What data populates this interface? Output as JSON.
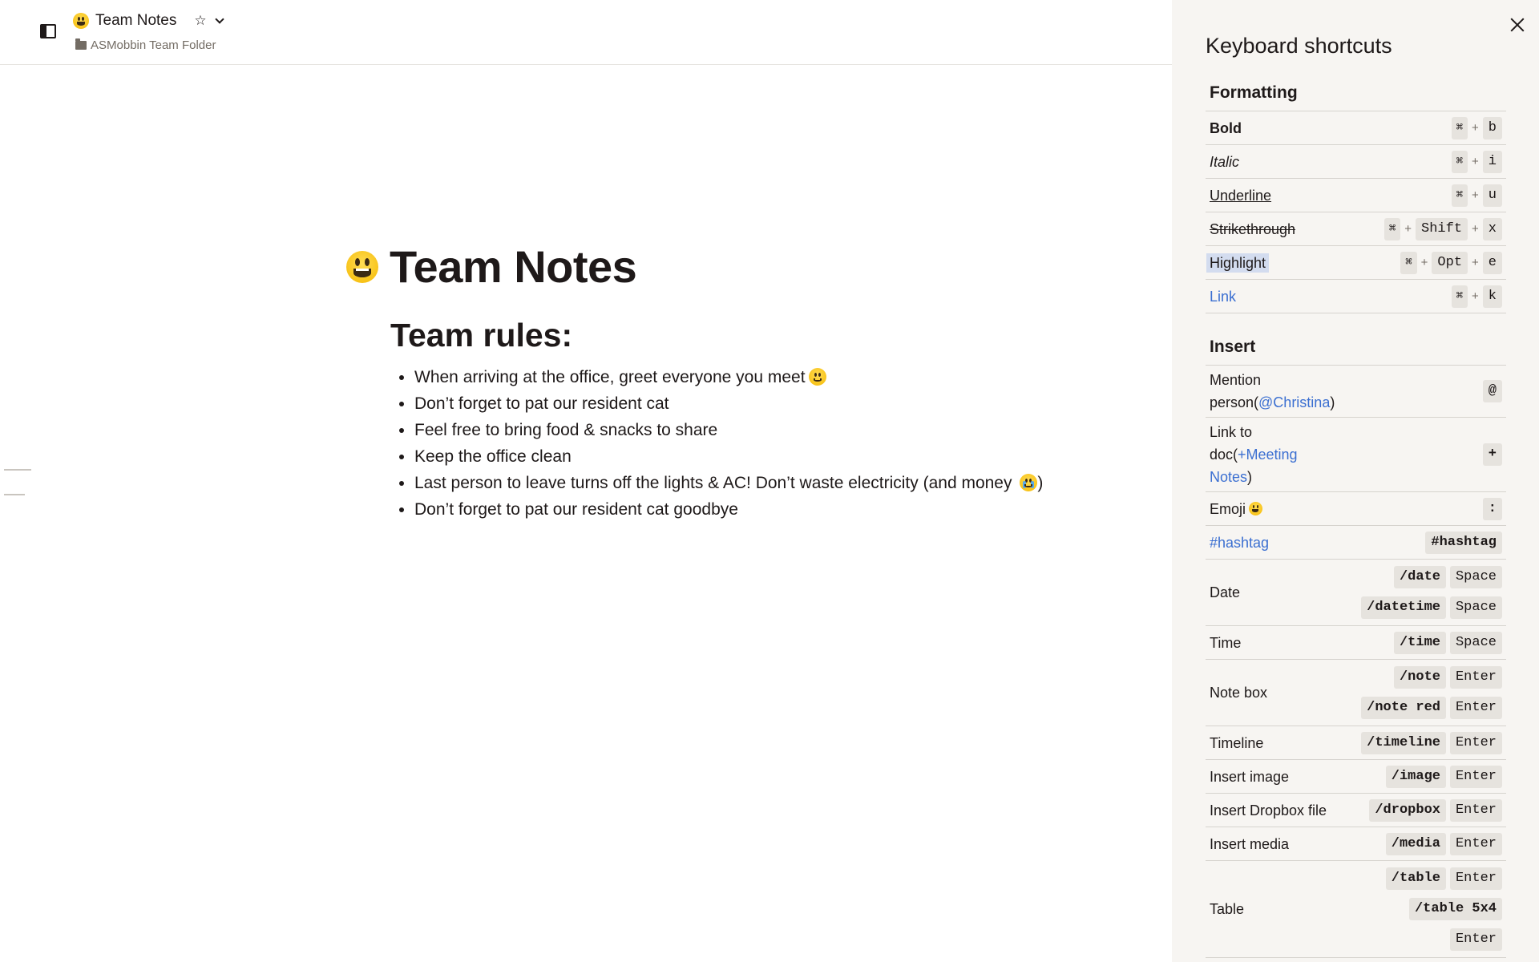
{
  "header": {
    "title": "Team Notes",
    "breadcrumb": "ASMobbin Team Folder"
  },
  "doc": {
    "title": "Team Notes",
    "section_title": "Team rules:",
    "rules": [
      "When arriving at the office, greet everyone you meet",
      "Don’t forget to pat our resident cat",
      "Feel free to bring food & snacks to share",
      "Keep the office clean",
      "Last person to leave turns off the lights & AC! Don’t waste electricity (and money",
      "Don’t forget to pat our resident cat goodbye"
    ],
    "rule5_close": ")"
  },
  "panel": {
    "title": "Keyboard shortcuts",
    "formatting_title": "Formatting",
    "insert_title": "Insert",
    "cmd": "⌘",
    "plus": "+",
    "formatting": {
      "bold": {
        "label": "Bold",
        "key": "b"
      },
      "italic": {
        "label": "Italic",
        "key": "i"
      },
      "underline": {
        "label": "Underline",
        "key": "u"
      },
      "strikethrough": {
        "label": "Strikethrough",
        "mod": "Shift",
        "key": "x"
      },
      "highlight": {
        "label": "Highlight",
        "mod": "Opt",
        "key": "e"
      },
      "link": {
        "label": "Link",
        "key": "k"
      }
    },
    "insert": {
      "mention": {
        "label_a": "Mention",
        "label_b": "person(",
        "accent": "@Christina",
        "close": ")",
        "key": "@"
      },
      "linkdoc": {
        "label_a": "Link to",
        "label_b": "doc(",
        "accent_a": "+Meeting",
        "accent_b": "Notes",
        "close": ")",
        "key": "+"
      },
      "emoji": {
        "label": "Emoji",
        "key": ":"
      },
      "hashtag": {
        "label": "#hashtag",
        "key": "#hashtag"
      },
      "date": {
        "label": "Date",
        "cmd1": "/date",
        "cmd2": "/datetime",
        "key": "Space"
      },
      "time": {
        "label": "Time",
        "cmd": "/time",
        "key": "Space"
      },
      "note": {
        "label": "Note box",
        "cmd1": "/note",
        "cmd2": "/note red",
        "key": "Enter"
      },
      "timeline": {
        "label": "Timeline",
        "cmd": "/timeline",
        "key": "Enter"
      },
      "image": {
        "label": "Insert image",
        "cmd": "/image",
        "key": "Enter"
      },
      "dropbox": {
        "label": "Insert Dropbox file",
        "cmd": "/dropbox",
        "key": "Enter"
      },
      "media": {
        "label": "Insert media",
        "cmd": "/media",
        "key": "Enter"
      },
      "table": {
        "label": "Table",
        "cmd1": "/table",
        "cmd2": "/table 5x4",
        "key": "Enter"
      }
    }
  },
  "colors": {
    "accent": "#3b6fd1",
    "panel_bg": "#f7f5f2",
    "key_bg": "#e6e3de",
    "highlight": "#d3dcef"
  },
  "icons": [
    "sidebar-toggle-icon",
    "grinning-emoji-icon",
    "star-icon",
    "chevron-down-icon",
    "folder-icon",
    "close-icon",
    "slightly-smiling-emoji-icon",
    "crying-emoji-icon"
  ]
}
